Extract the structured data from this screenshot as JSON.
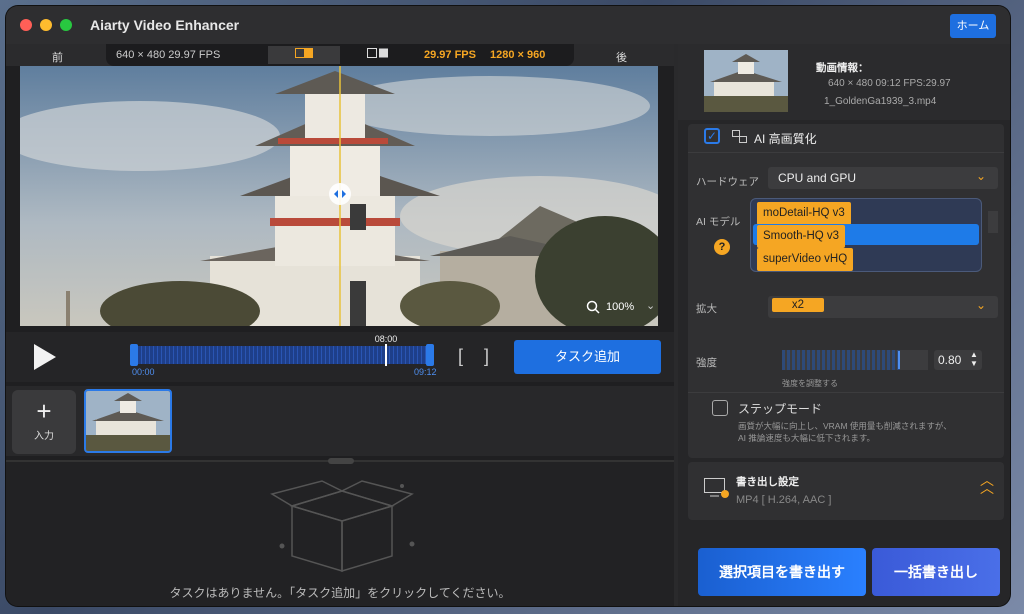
{
  "window": {
    "title": "Aiarty Video Enhancer",
    "home_label": "ホーム",
    "traffic_colors": [
      "#ff5f57",
      "#febc2e",
      "#28c840"
    ]
  },
  "compare_bar": {
    "before_label": "前",
    "before_info": "640 × 480  29.97 FPS",
    "after_fps": "29.97 FPS",
    "after_res": "1280 × 960",
    "after_label": "後"
  },
  "video": {
    "zoom": "100%"
  },
  "timeline": {
    "current_time": "08:00",
    "start_time": "00:00",
    "end_time": "09:12",
    "task_add_label": "タスク追加"
  },
  "thumbs": {
    "input_label": "入力"
  },
  "queue": {
    "empty_text": "タスクはありません。「タスク追加」をクリックしてください。"
  },
  "info": {
    "title": "動画情報：",
    "details": "640 × 480  09:12  FPS:29.97",
    "filename": "1_GoldenGa1939_3.mp4"
  },
  "ai": {
    "section_label": "AI 高画質化",
    "hardware_label": "ハードウェア",
    "hardware_value": "CPU and GPU",
    "model_label": "AI モデル",
    "model_options": [
      "moDetail-HQ  v3",
      "Smooth-HQ  v3",
      "superVideo vHQ"
    ],
    "scale_label": "拡大",
    "scale_value": "x2",
    "strength_label": "強度",
    "strength_value": "0.80",
    "strength_hint": "強度を調整する",
    "step_mode_label": "ステップモード",
    "step_mode_desc_1": "画質が大幅に向上し、VRAM 使用量も削減されますが、",
    "step_mode_desc_2": "AI 推論速度も大幅に低下されます。"
  },
  "export": {
    "title": "書き出し設定",
    "format": "MP4 [ H.264, AAC ]",
    "export_selected": "選択項目を書き出す",
    "export_all": "一括書き出し"
  },
  "colors": {
    "accent": "#1e6fe0",
    "orange": "#f5a623"
  }
}
